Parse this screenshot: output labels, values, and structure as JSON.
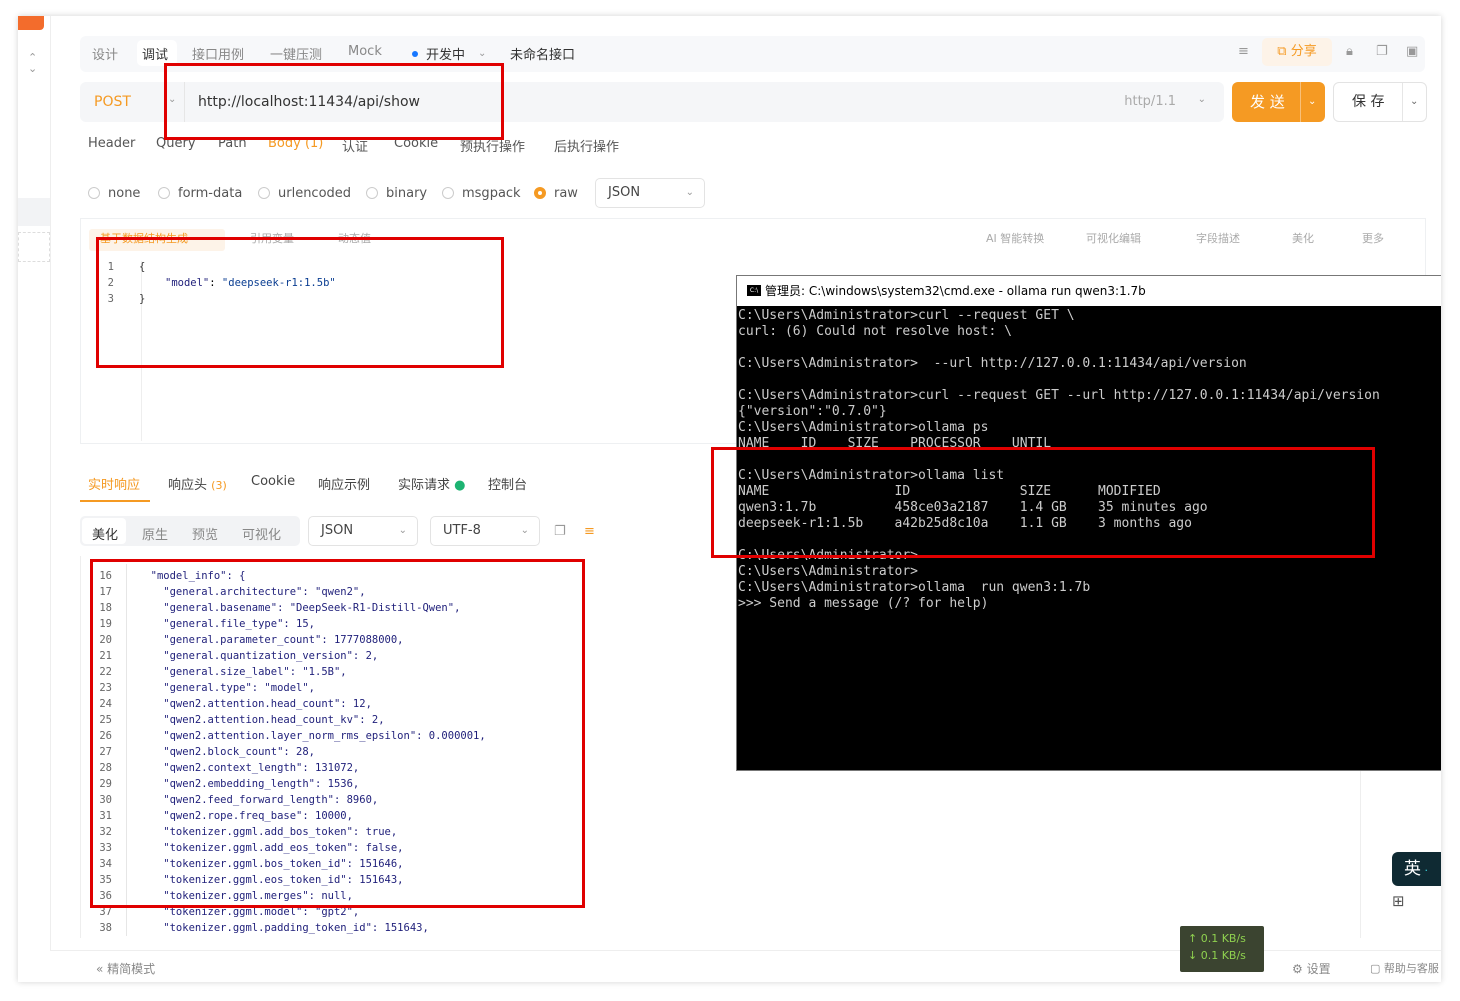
{
  "toptabs": {
    "design": "设计",
    "debug": "调试",
    "cases": "接口用例",
    "stress": "一键压测",
    "mock": "Mock",
    "status": "开发中",
    "api_name": "未命名接口",
    "share": "分享"
  },
  "request": {
    "method": "POST",
    "url": "http://localhost:11434/api/show",
    "http_version": "http/1.1",
    "send": "发 送",
    "save": "保 存"
  },
  "req_tabs": [
    "Header",
    "Query",
    "Path",
    "Body (1)",
    "认证",
    "Cookie",
    "预执行操作",
    "后执行操作"
  ],
  "body_types": [
    "none",
    "form-data",
    "urlencoded",
    "binary",
    "msgpack",
    "raw"
  ],
  "body_format": "JSON",
  "editor_tools": {
    "gen": "基于数据结构生成",
    "dynamic_var": "引用变量",
    "dynamic_val": "动态值",
    "ai": "AI 智能转换",
    "visual": "可视化编辑",
    "field": "字段描述",
    "beautify": "美化",
    "more": "更多"
  },
  "body_code": {
    "line_numbers": [
      "1",
      "2",
      "3"
    ],
    "line1": "{",
    "line2_key": "\"model\"",
    "line2_val": "\"deepseek-r1:1.5b\"",
    "line3": "}"
  },
  "resp_tabs": {
    "realtime": "实时响应",
    "headers": "响应头",
    "headers_count": "(3)",
    "cookie": "Cookie",
    "example": "响应示例",
    "actual": "实际请求",
    "console": "控制台"
  },
  "view_tabs": [
    "美化",
    "原生",
    "预览",
    "可视化"
  ],
  "view_format": "JSON",
  "view_encoding": "UTF-8",
  "response_lines": [
    {
      "n": "16",
      "t": "  \"model_info\": {"
    },
    {
      "n": "17",
      "t": "    \"general.architecture\": \"qwen2\","
    },
    {
      "n": "18",
      "t": "    \"general.basename\": \"DeepSeek-R1-Distill-Qwen\","
    },
    {
      "n": "19",
      "t": "    \"general.file_type\": 15,"
    },
    {
      "n": "20",
      "t": "    \"general.parameter_count\": 1777088000,"
    },
    {
      "n": "21",
      "t": "    \"general.quantization_version\": 2,"
    },
    {
      "n": "22",
      "t": "    \"general.size_label\": \"1.5B\","
    },
    {
      "n": "23",
      "t": "    \"general.type\": \"model\","
    },
    {
      "n": "24",
      "t": "    \"qwen2.attention.head_count\": 12,"
    },
    {
      "n": "25",
      "t": "    \"qwen2.attention.head_count_kv\": 2,"
    },
    {
      "n": "26",
      "t": "    \"qwen2.attention.layer_norm_rms_epsilon\": 0.000001,"
    },
    {
      "n": "27",
      "t": "    \"qwen2.block_count\": 28,"
    },
    {
      "n": "28",
      "t": "    \"qwen2.context_length\": 131072,"
    },
    {
      "n": "29",
      "t": "    \"qwen2.embedding_length\": 1536,"
    },
    {
      "n": "30",
      "t": "    \"qwen2.feed_forward_length\": 8960,"
    },
    {
      "n": "31",
      "t": "    \"qwen2.rope.freq_base\": 10000,"
    },
    {
      "n": "32",
      "t": "    \"tokenizer.ggml.add_bos_token\": true,"
    },
    {
      "n": "33",
      "t": "    \"tokenizer.ggml.add_eos_token\": false,"
    },
    {
      "n": "34",
      "t": "    \"tokenizer.ggml.bos_token_id\": 151646,"
    },
    {
      "n": "35",
      "t": "    \"tokenizer.ggml.eos_token_id\": 151643,"
    },
    {
      "n": "36",
      "t": "    \"tokenizer.ggml.merges\": null,"
    },
    {
      "n": "37",
      "t": "    \"tokenizer.ggml.model\": \"gpt2\","
    },
    {
      "n": "38",
      "t": "    \"tokenizer.ggml.padding_token_id\": 151643,"
    }
  ],
  "cmd": {
    "title": "管理员: C:\\windows\\system32\\cmd.exe - ollama   run qwen3:1.7b",
    "lines": [
      "C:\\Users\\Administrator>curl --request GET \\",
      "curl: (6) Could not resolve host: \\",
      "",
      "C:\\Users\\Administrator>  --url http://127.0.0.1:11434/api/version",
      "",
      "C:\\Users\\Administrator>curl --request GET --url http://127.0.0.1:11434/api/version",
      "{\"version\":\"0.7.0\"}",
      "C:\\Users\\Administrator>ollama ps",
      "NAME    ID    SIZE    PROCESSOR    UNTIL",
      "",
      "C:\\Users\\Administrator>ollama list",
      "NAME                ID              SIZE      MODIFIED",
      "qwen3:1.7b          458ce03a2187    1.4 GB    35 minutes ago",
      "deepseek-r1:1.5b    a42b25d8c10a    1.1 GB    3 months ago",
      "",
      "C:\\Users\\Administrator>",
      "C:\\Users\\Administrator>",
      "C:\\Users\\Administrator>ollama  run qwen3:1.7b",
      ">>> Send a message (/? for help)"
    ]
  },
  "ime": "英",
  "net": {
    "up": "↑ 0.1 KB/s",
    "down": "↓ 0.1 KB/s"
  },
  "bottom": {
    "simple_mode": "精简模式",
    "settings": "设置",
    "help": "帮助与客服"
  }
}
